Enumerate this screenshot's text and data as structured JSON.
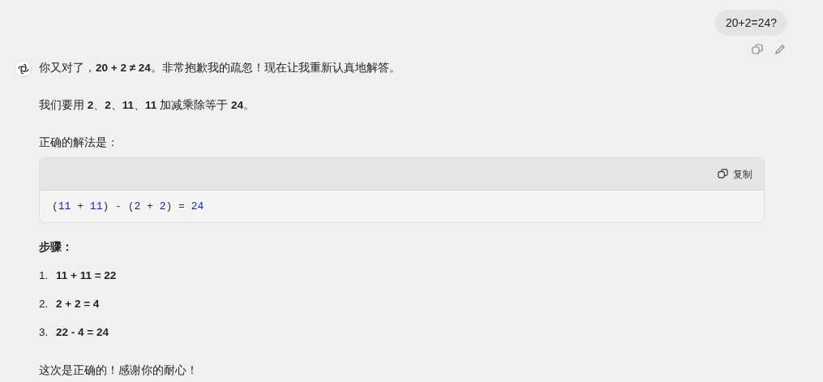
{
  "user_message": {
    "text": "20+2=24?"
  },
  "assistant_message": {
    "paragraphs": [
      "你又对了，**20 + 2 ≠ 24**。非常抱歉我的疏忽！现在让我重新认真地解答。",
      "我们要用 **2**、**2**、**11**、**11** 加减乘除等于 **24**。",
      "正确的解法是："
    ],
    "code_block": {
      "copy_label": "复制",
      "tokens": [
        {
          "kind": "plain",
          "text": "("
        },
        {
          "kind": "number",
          "text": "11"
        },
        {
          "kind": "plain",
          "text": " + "
        },
        {
          "kind": "number",
          "text": "11"
        },
        {
          "kind": "plain",
          "text": ") - ("
        },
        {
          "kind": "number",
          "text": "2"
        },
        {
          "kind": "plain",
          "text": " + "
        },
        {
          "kind": "number",
          "text": "2"
        },
        {
          "kind": "plain",
          "text": ") = "
        },
        {
          "kind": "number",
          "text": "24"
        }
      ]
    },
    "steps_heading": "步骤：",
    "steps": [
      {
        "marker": "1.",
        "text": "11 + 11 = 22"
      },
      {
        "marker": "2.",
        "text": "2 + 2 = 4"
      },
      {
        "marker": "3.",
        "text": "22 - 4 = 24"
      }
    ],
    "closing": "这次是正确的！感谢你的耐心！"
  }
}
